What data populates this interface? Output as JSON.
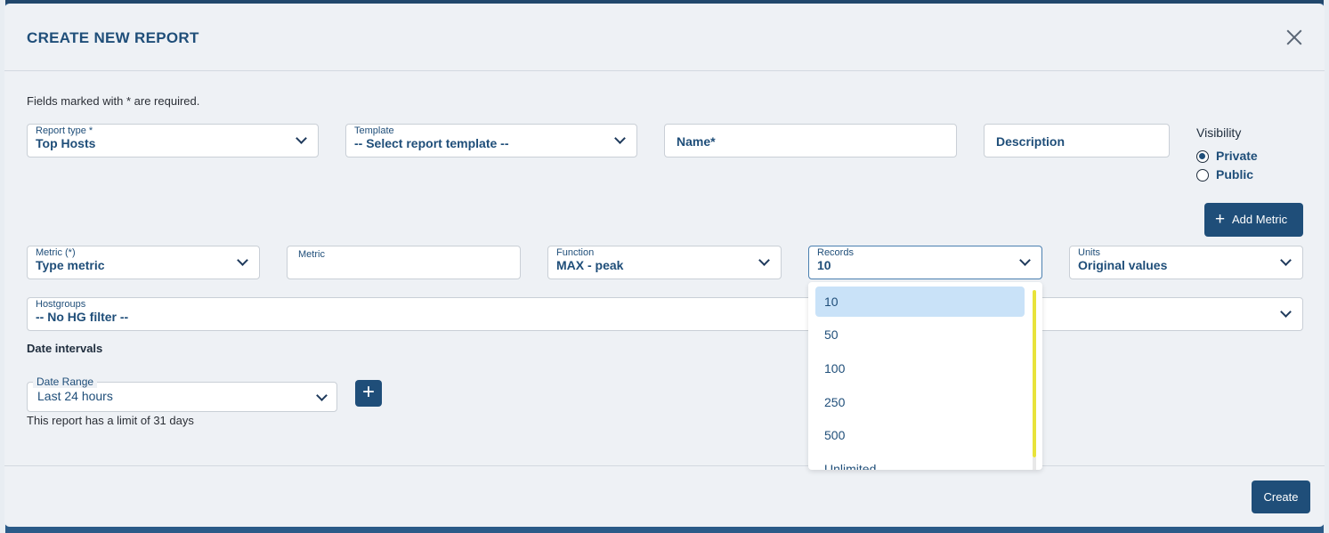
{
  "modal": {
    "title": "CREATE NEW REPORT",
    "required_note": "Fields marked with * are required."
  },
  "report_type": {
    "label": "Report type *",
    "value": "Top Hosts"
  },
  "template": {
    "label": "Template",
    "value": "-- Select report template --"
  },
  "name": {
    "placeholder": "Name*"
  },
  "description": {
    "placeholder": "Description"
  },
  "visibility": {
    "label": "Visibility",
    "options": [
      "Private",
      "Public"
    ],
    "selected": "Private"
  },
  "add_metric_label": "Add Metric",
  "metric_select": {
    "label": "Metric (*)",
    "value": "Type metric"
  },
  "metric_input": {
    "label": "Metric"
  },
  "function": {
    "label": "Function",
    "value": "MAX - peak"
  },
  "records": {
    "label": "Records",
    "value": "10",
    "options": [
      "10",
      "50",
      "100",
      "250",
      "500",
      "Unlimited"
    ]
  },
  "units": {
    "label": "Units",
    "value": "Original values"
  },
  "hostgroups": {
    "label": "Hostgroups",
    "value": "-- No HG filter --"
  },
  "date_intervals": {
    "title": "Date intervals",
    "range_label": "Date Range",
    "range_value": "Last 24 hours",
    "limit_note": "This report has a limit of 31 days"
  },
  "create_label": "Create",
  "colors": {
    "primary": "#1f4e79",
    "selected_option": "#c9e2f8",
    "scrollbar": "#e8e33a"
  }
}
